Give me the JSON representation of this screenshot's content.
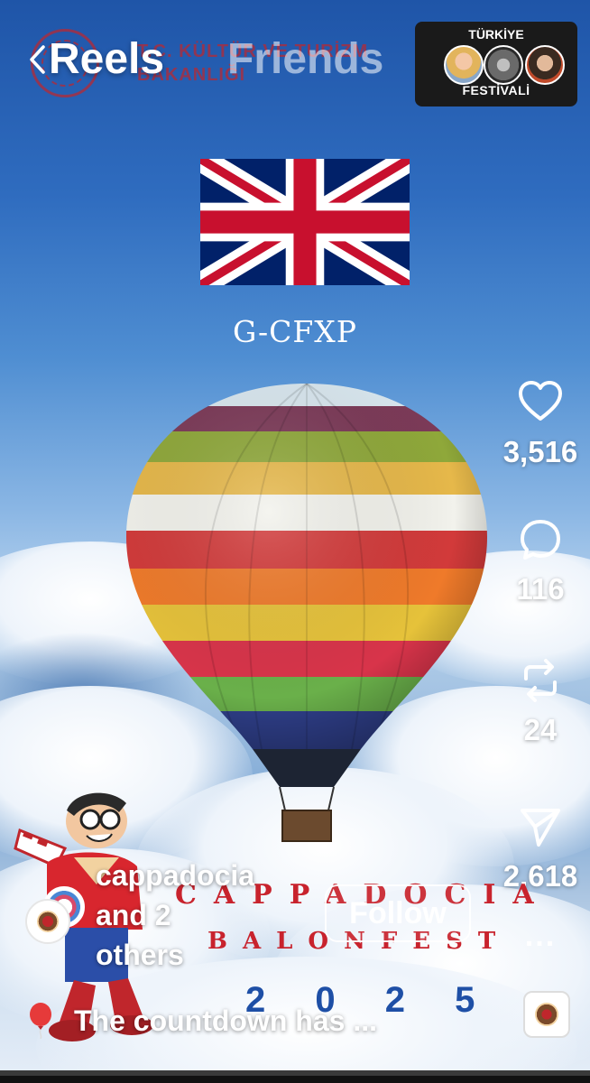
{
  "app": {
    "tabs": [
      {
        "label": "Reels",
        "active": true
      },
      {
        "label": "Friends",
        "active": false
      }
    ]
  },
  "watermark": {
    "ministry_line1": "T.C. KÜLTÜR VE TURİZM",
    "ministry_line2": "BAKANLIĞI"
  },
  "festival_panel": {
    "top": "TÜRKİYE",
    "bottom": "FESTİVALİ"
  },
  "video": {
    "flag": "united-kingdom-flag",
    "registration": "G-CFXP",
    "event_line1": "CAPPADOCIA",
    "event_line2": "BALONFEST",
    "event_year": "2 0 2 5"
  },
  "actions": {
    "likes": "3,516",
    "comments": "116",
    "reposts": "24",
    "shares": "2,618",
    "more": "..."
  },
  "post": {
    "owner_line1": "cappadocia",
    "owner_line2": "and 2",
    "owner_line3": "others",
    "follow_label": "Follow",
    "caption": "The countdown has ..."
  },
  "colors": {
    "sky_top": "#1f55a8",
    "event_red": "#c8232d",
    "event_blue": "#1e4fa6"
  },
  "icons": [
    "chevron-left-icon",
    "heart-icon",
    "comment-icon",
    "repost-icon",
    "send-icon",
    "more-icon",
    "balloon-emoji-icon"
  ]
}
